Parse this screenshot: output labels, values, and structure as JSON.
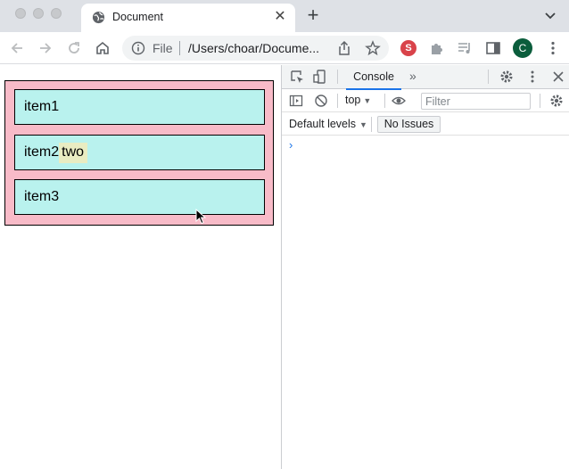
{
  "browser": {
    "tab": {
      "title": "Document",
      "favicon": "globe-icon",
      "close": "✕"
    },
    "new_tab": "+",
    "toolbar": {
      "scheme": "File",
      "url": "/Users/choar/Docume...",
      "extensions": [
        {
          "name": "S",
          "color": "#d9434a"
        }
      ],
      "avatar_letter": "C",
      "avatar_color": "#0b5d3c"
    }
  },
  "page": {
    "items": [
      {
        "label": "item1"
      },
      {
        "label": "item2",
        "highlight": "two"
      },
      {
        "label": "item3"
      }
    ],
    "colors": {
      "container": "#f8bbc8",
      "item": "#b9f2ee",
      "highlight": "#e9ecc2"
    }
  },
  "devtools": {
    "tabs": {
      "active": "Console",
      "more": "»"
    },
    "toolbar": {
      "context": "top",
      "filter_placeholder": "Filter"
    },
    "levels": {
      "label": "Default levels",
      "issues": "No Issues"
    },
    "prompt": "›"
  }
}
